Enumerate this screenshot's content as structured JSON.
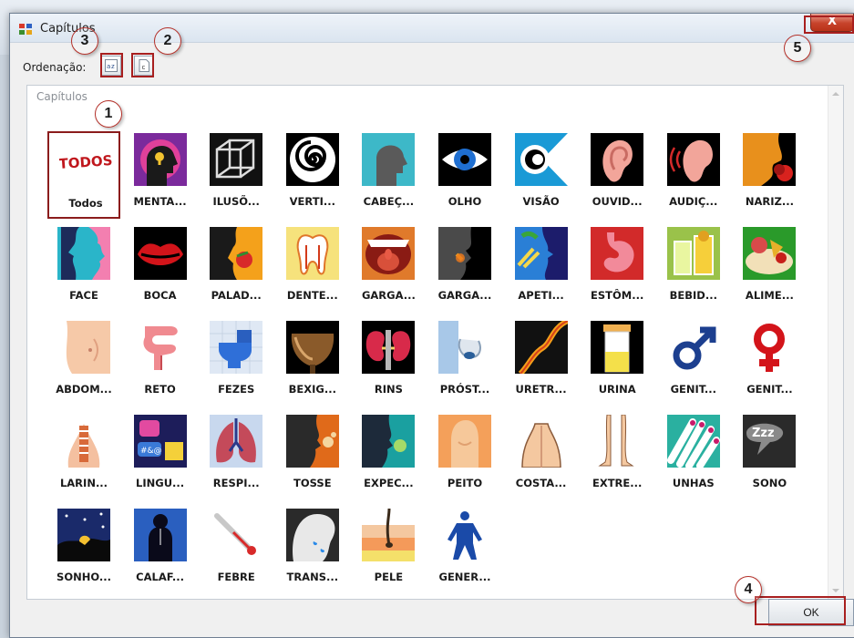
{
  "window": {
    "title": "Capítulos",
    "close_label": "X"
  },
  "sort": {
    "label": "Ordenação:"
  },
  "group": {
    "title": "Capítulos"
  },
  "ok_label": "OK",
  "callouts": [
    "1",
    "2",
    "3",
    "4",
    "5"
  ],
  "tiles": [
    {
      "label": "Todos",
      "icon": "todos-icon"
    },
    {
      "label": "MENTA...",
      "icon": "mind-icon"
    },
    {
      "label": "ILUSÕ...",
      "icon": "illusion-cube-icon"
    },
    {
      "label": "VERTI...",
      "icon": "spiral-icon"
    },
    {
      "label": "CABEÇ...",
      "icon": "head-icon"
    },
    {
      "label": "OLHO",
      "icon": "eye-icon"
    },
    {
      "label": "VISÃO",
      "icon": "vision-icon"
    },
    {
      "label": "OUVID...",
      "icon": "ear-icon"
    },
    {
      "label": "AUDIÇ...",
      "icon": "hearing-icon"
    },
    {
      "label": "NARIZ...",
      "icon": "nose-icon"
    },
    {
      "label": "FACE",
      "icon": "face-icon"
    },
    {
      "label": "BOCA",
      "icon": "mouth-icon"
    },
    {
      "label": "PALAD...",
      "icon": "taste-icon"
    },
    {
      "label": "DENTE...",
      "icon": "tooth-icon"
    },
    {
      "label": "GARGA...",
      "icon": "throat-icon"
    },
    {
      "label": "GARGA...",
      "icon": "throat-profile-icon"
    },
    {
      "label": "APETI...",
      "icon": "appetite-icon"
    },
    {
      "label": "ESTÔM...",
      "icon": "stomach-icon"
    },
    {
      "label": "BEBID...",
      "icon": "drinks-icon"
    },
    {
      "label": "ALIME...",
      "icon": "food-icon"
    },
    {
      "label": "ABDOM...",
      "icon": "abdomen-icon"
    },
    {
      "label": "RETO",
      "icon": "rectum-icon"
    },
    {
      "label": "FEZES",
      "icon": "toilet-icon"
    },
    {
      "label": "BEXIG...",
      "icon": "bladder-icon"
    },
    {
      "label": "RINS",
      "icon": "kidneys-icon"
    },
    {
      "label": "PRÓST...",
      "icon": "prostate-icon"
    },
    {
      "label": "URETR...",
      "icon": "urethra-icon"
    },
    {
      "label": "URINA",
      "icon": "urine-icon"
    },
    {
      "label": "GENIT...",
      "icon": "male-symbol-icon"
    },
    {
      "label": "GENIT...",
      "icon": "female-symbol-icon"
    },
    {
      "label": "LARIN...",
      "icon": "larynx-icon"
    },
    {
      "label": "LINGU...",
      "icon": "speech-icon"
    },
    {
      "label": "RESPI...",
      "icon": "lungs-icon"
    },
    {
      "label": "TOSSE",
      "icon": "cough-icon"
    },
    {
      "label": "EXPEC...",
      "icon": "expectoration-icon"
    },
    {
      "label": "PEITO",
      "icon": "chest-icon"
    },
    {
      "label": "COSTA...",
      "icon": "back-icon"
    },
    {
      "label": "EXTRE...",
      "icon": "legs-icon"
    },
    {
      "label": "UNHAS",
      "icon": "nails-icon"
    },
    {
      "label": "SONO",
      "icon": "sleep-icon"
    },
    {
      "label": "SONHO...",
      "icon": "dreams-icon"
    },
    {
      "label": "CALAF...",
      "icon": "chills-icon"
    },
    {
      "label": "FEBRE",
      "icon": "thermometer-icon"
    },
    {
      "label": "TRANS...",
      "icon": "sweat-icon"
    },
    {
      "label": "PELE",
      "icon": "skin-icon"
    },
    {
      "label": "GENER...",
      "icon": "body-icon"
    }
  ],
  "colors": {
    "highlight": "#a81f1f",
    "selected_border": "#8b1c1c",
    "close": "#c7432b"
  }
}
